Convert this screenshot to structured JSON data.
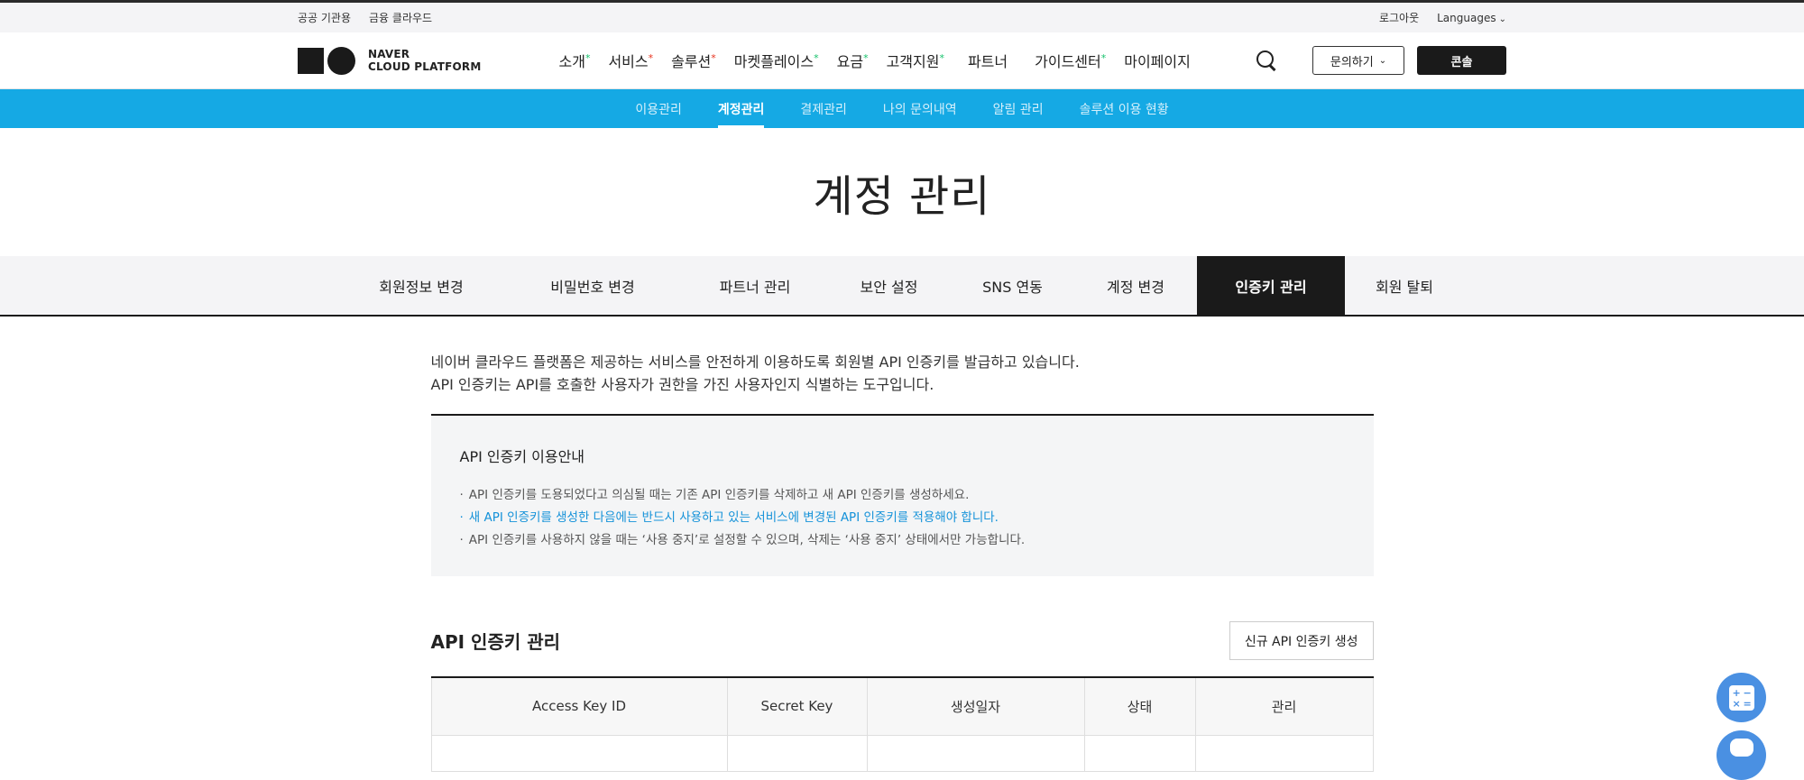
{
  "utility": {
    "left": [
      "공공 기관용",
      "금융 클라우드"
    ],
    "logout": "로그아웃",
    "languages": "Languages"
  },
  "logo": {
    "line1": "NAVER",
    "line2": "CLOUD PLATFORM"
  },
  "gnb": [
    {
      "label": "소개",
      "mark": "green"
    },
    {
      "label": "서비스",
      "mark": "red"
    },
    {
      "label": "솔루션",
      "mark": "red"
    },
    {
      "label": "마켓플레이스",
      "mark": "green"
    },
    {
      "label": "요금",
      "mark": "green"
    },
    {
      "label": "고객지원",
      "mark": "green"
    },
    {
      "label": "파트너",
      "mark": ""
    },
    {
      "label": "가이드센터",
      "mark": "green"
    },
    {
      "label": "마이페이지",
      "mark": ""
    }
  ],
  "header_buttons": {
    "inquiry": "문의하기",
    "console": "콘솔"
  },
  "subnav": [
    "이용관리",
    "계정관리",
    "결제관리",
    "나의 문의내역",
    "알림 관리",
    "솔루션 이용 현황"
  ],
  "subnav_active": 1,
  "page_title": "계정 관리",
  "tabs": [
    "회원정보 변경",
    "비밀번호 변경",
    "파트너 관리",
    "보안 설정",
    "SNS 연동",
    "계정 변경",
    "인증키 관리",
    "회원 탈퇴"
  ],
  "tabs_active": 6,
  "intro": {
    "line1": "네이버 클라우드 플랫폼은 제공하는 서비스를 안전하게 이용하도록 회원별 API 인증키를 발급하고 있습니다.",
    "line2": "API 인증키는 API를 호출한 사용자가 권한을 가진 사용자인지 식별하는 도구입니다."
  },
  "notice": {
    "title": "API 인증키 이용안내",
    "items": [
      "API 인증키를 도용되었다고 의심될 때는 기존 API 인증키를 삭제하고 새 API 인증키를 생성하세요.",
      "새 API 인증키를 생성한 다음에는 반드시 사용하고 있는 서비스에 변경된 API 인증키를 적용해야 합니다.",
      "API 인증키를 사용하지 않을 때는 ‘사용 중지’로 설정할 수 있으며, 삭제는 ‘사용 중지’ 상태에서만 가능합니다."
    ]
  },
  "keys": {
    "title": "API 인증키 관리",
    "new_button": "신규 API 인증키 생성",
    "columns": [
      "Access Key ID",
      "Secret Key",
      "생성일자",
      "상태",
      "관리"
    ]
  },
  "colors": {
    "accent": "#15a9e4",
    "dark": "#1a1a1a",
    "link_blue": "#1592d9",
    "float_blue": "#4a90e2"
  }
}
